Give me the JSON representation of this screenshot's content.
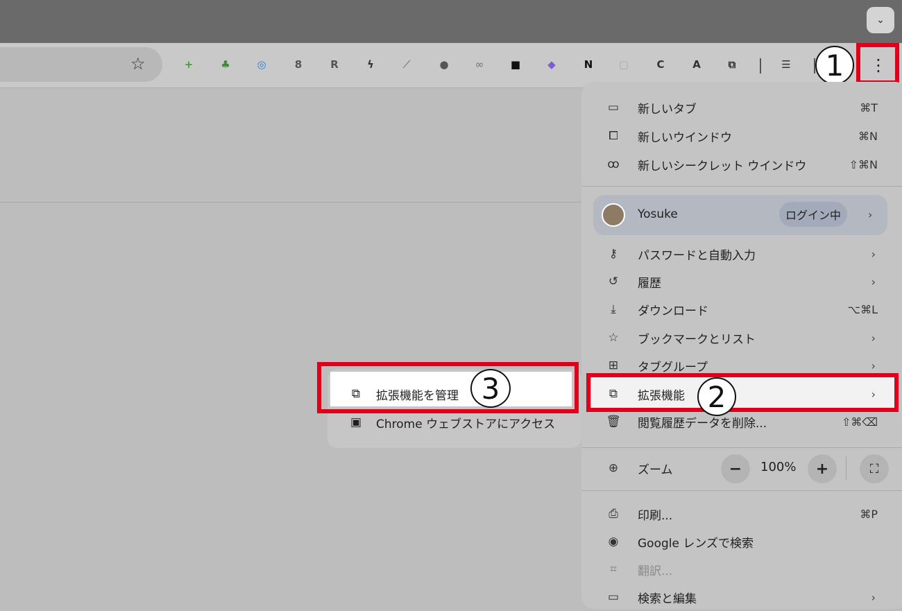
{
  "extensions": [
    {
      "name": "plus-ext-icon",
      "glyph": "+",
      "color": "#3aa33a"
    },
    {
      "name": "puzzle-leaf-ext-icon",
      "glyph": "♣",
      "color": "#3f8a35"
    },
    {
      "name": "gauge-ext-icon",
      "glyph": "◎",
      "color": "#2a7fd4"
    },
    {
      "name": "google-ext-icon",
      "glyph": "8",
      "color": "#555"
    },
    {
      "name": "r-ext-icon",
      "glyph": "R",
      "color": "#555"
    },
    {
      "name": "bolt-ext-icon",
      "glyph": "ϟ",
      "color": "#333"
    },
    {
      "name": "tool-ext-icon",
      "glyph": "⟋",
      "color": "#888"
    },
    {
      "name": "elephant-ext-icon",
      "glyph": "●",
      "color": "#555"
    },
    {
      "name": "binoculars-ext-icon",
      "glyph": "∞",
      "color": "#888"
    },
    {
      "name": "glasses-ext-icon",
      "glyph": "■",
      "color": "#111"
    },
    {
      "name": "obsidian-ext-icon",
      "glyph": "◆",
      "color": "#7c5cd6"
    },
    {
      "name": "notion-ext-icon",
      "glyph": "N",
      "color": "#111"
    },
    {
      "name": "bulb-ext-icon",
      "glyph": "▢",
      "color": "#aaa"
    },
    {
      "name": "copy-ext-icon",
      "glyph": "C",
      "color": "#333"
    },
    {
      "name": "translate-ext-icon",
      "glyph": "A",
      "color": "#333"
    },
    {
      "name": "puzzle-ext-icon",
      "glyph": "⧉",
      "color": "#333"
    },
    {
      "name": "reading-list-icon",
      "glyph": "☰",
      "color": "#333"
    }
  ],
  "callouts": {
    "one": "1",
    "two": "2",
    "three": "3"
  },
  "menu": {
    "new_tab": {
      "label": "新しいタブ",
      "shortcut": "⌘T"
    },
    "new_window": {
      "label": "新しいウインドウ",
      "shortcut": "⌘N"
    },
    "new_incognito": {
      "label": "新しいシークレット ウインドウ",
      "shortcut": "⇧⌘N"
    },
    "profile": {
      "name": "Yosuke",
      "status": "ログイン中"
    },
    "passwords": {
      "label": "パスワードと自動入力"
    },
    "history": {
      "label": "履歴"
    },
    "downloads": {
      "label": "ダウンロード",
      "shortcut": "⌥⌘L"
    },
    "bookmarks": {
      "label": "ブックマークとリスト"
    },
    "tab_groups": {
      "label": "タブグループ"
    },
    "extensions": {
      "label": "拡張機能"
    },
    "clear_data": {
      "label": "閲覧履歴データを削除...",
      "shortcut": "⇧⌘⌫"
    },
    "zoom": {
      "label": "ズーム",
      "value": "100%",
      "minus": "−",
      "plus": "+"
    },
    "print": {
      "label": "印刷...",
      "shortcut": "⌘P"
    },
    "lens": {
      "label": "Google レンズで検索"
    },
    "translate": {
      "label": "翻訳..."
    },
    "find_edit": {
      "label": "検索と編集"
    }
  },
  "submenu": {
    "manage": {
      "label": "拡張機能を管理"
    },
    "webstore": {
      "label": "Chrome ウェブストアにアクセス"
    }
  }
}
